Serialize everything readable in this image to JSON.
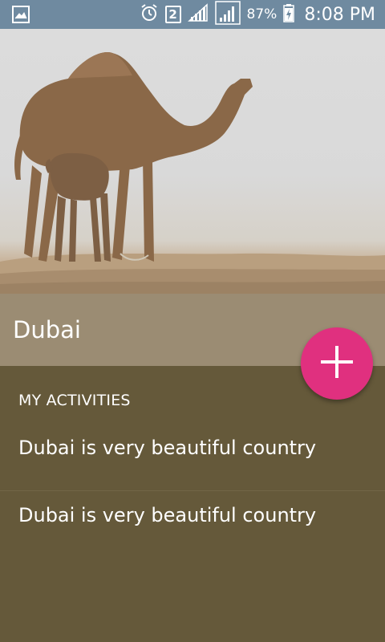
{
  "status_bar": {
    "sim_slot": "2",
    "battery": "87%",
    "time": "8:08 PM",
    "icons": [
      "gallery-notification-icon",
      "alarm-icon",
      "sim-2-icon",
      "signal-1-icon",
      "signal-2-icon",
      "battery-charging-icon"
    ]
  },
  "hero": {
    "image_subject": "camel-with-calf-in-desert-image"
  },
  "place": {
    "title": "Dubai"
  },
  "activities": {
    "header": "MY ACTIVITIES",
    "items": [
      {
        "label": "Dubai is very beautiful country"
      },
      {
        "label": "Dubai is very beautiful country"
      }
    ]
  },
  "fab": {
    "icon": "plus-icon"
  },
  "colors": {
    "status_bar": "#6f8aa0",
    "title_band": "#9b8c73",
    "content_bg": "#65593a",
    "fab_accent": "#e0307f"
  }
}
